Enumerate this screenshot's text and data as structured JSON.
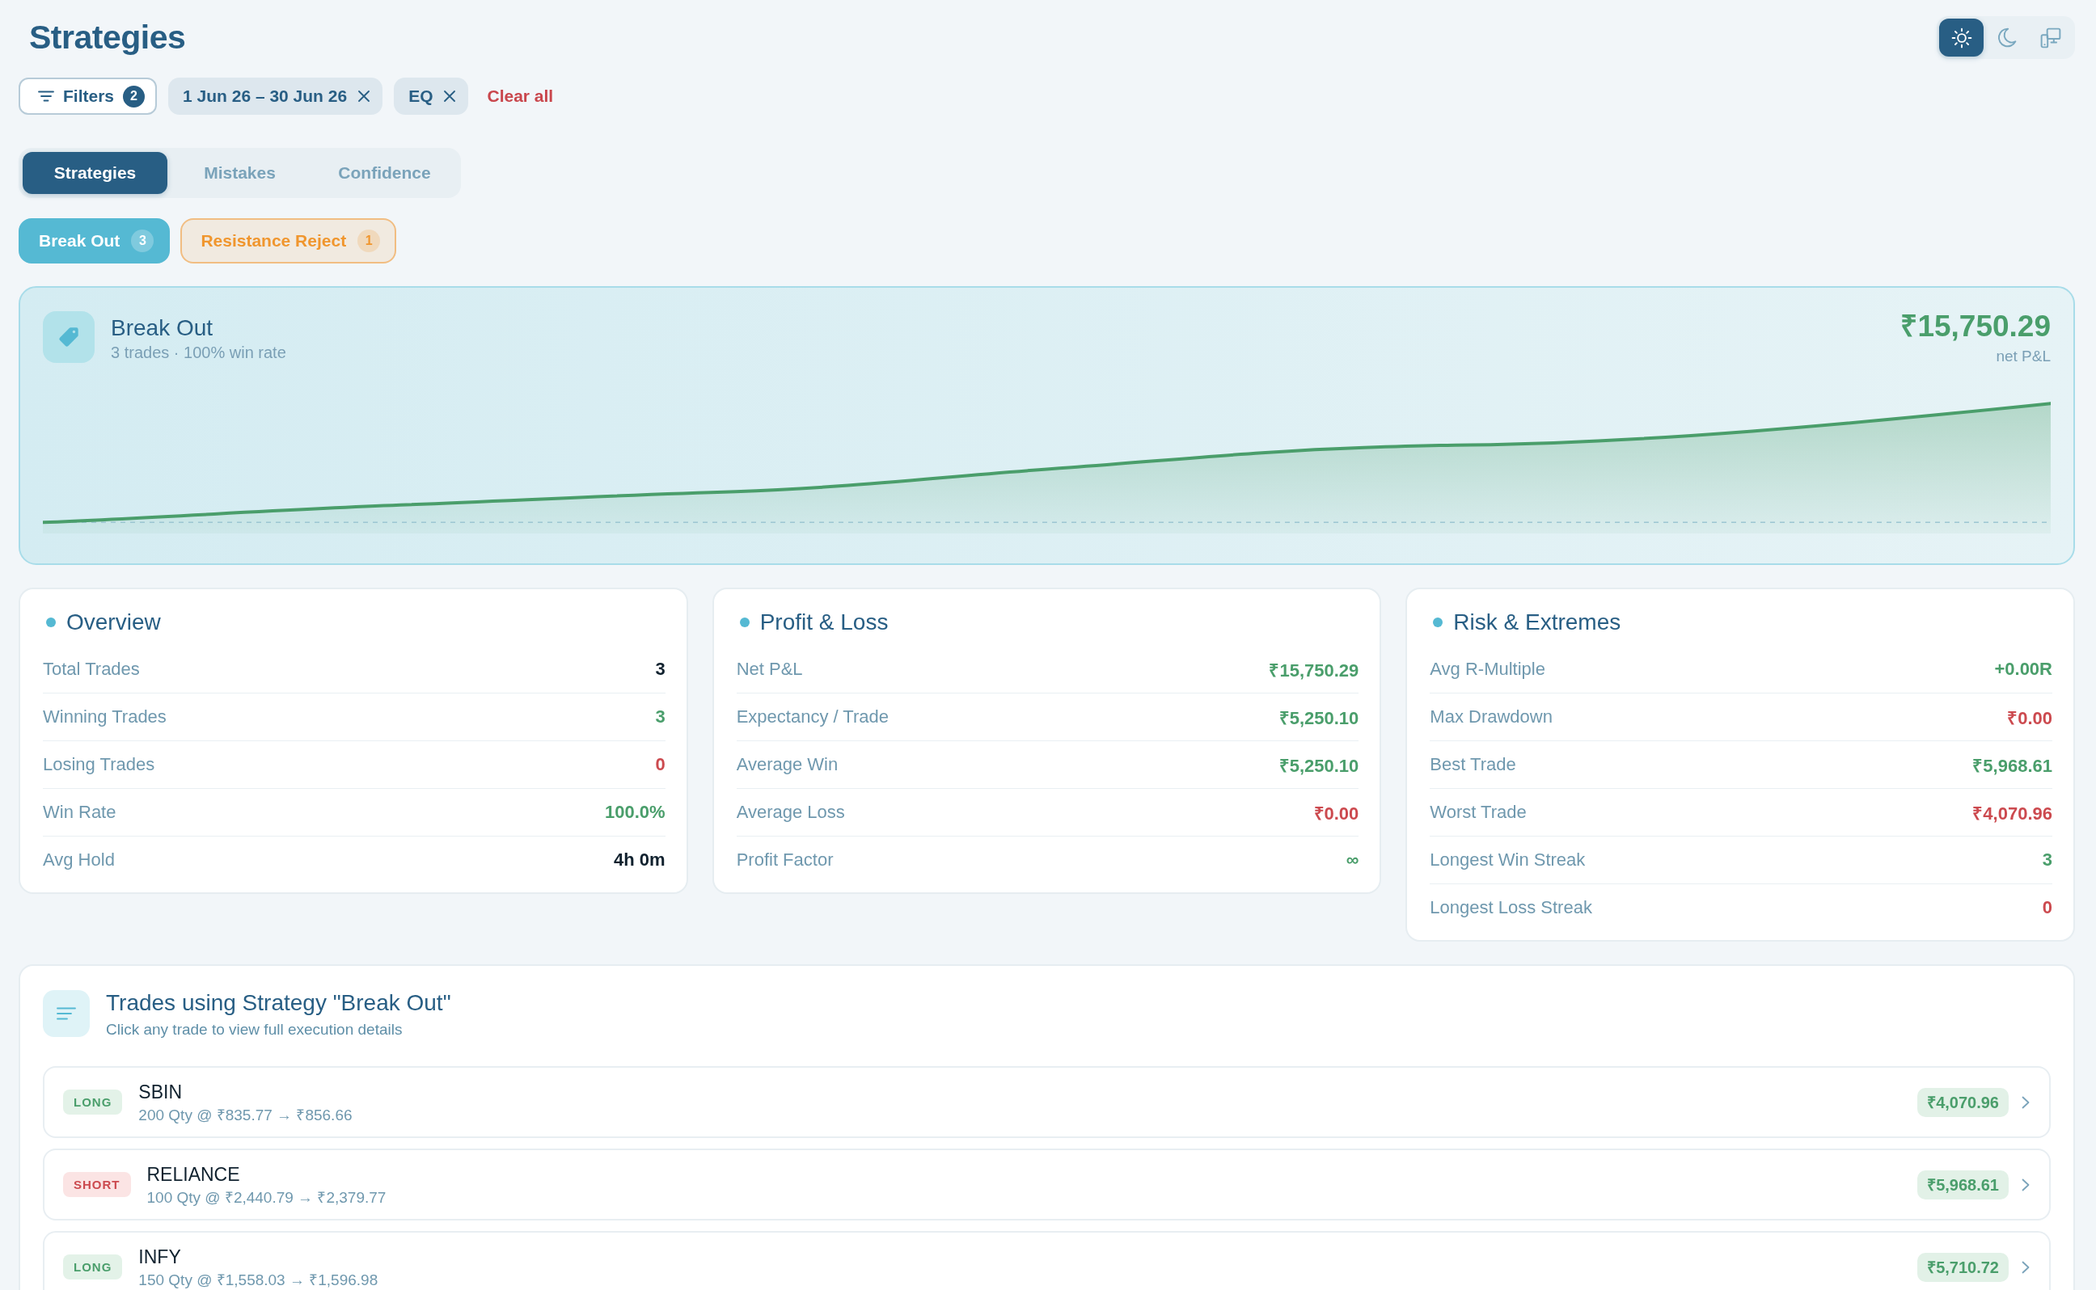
{
  "page_title": "Strategies",
  "theme_options": [
    {
      "kind": "light",
      "selected": true
    },
    {
      "kind": "dark",
      "selected": false
    },
    {
      "kind": "system",
      "selected": false
    }
  ],
  "filters": {
    "label": "Filters",
    "count": "2"
  },
  "active_filters": [
    {
      "label": "1 Jun 26 – 30 Jun 26"
    },
    {
      "label": "EQ"
    }
  ],
  "clear_all": "Clear all",
  "tabs": [
    {
      "label": "Strategies",
      "selected": true
    },
    {
      "label": "Mistakes",
      "selected": false
    },
    {
      "label": "Confidence",
      "selected": false
    }
  ],
  "strategy_chips": [
    {
      "label": "Break Out",
      "count": "3",
      "color": "#55b9d3",
      "selected": true
    },
    {
      "label": "Resistance Reject",
      "count": "1",
      "color": "#f0962e",
      "selected": false
    }
  ],
  "summary": {
    "title": "Break Out",
    "subtitle": "3 trades · 100% win rate",
    "net_pnl": "₹15,750.29",
    "net_pnl_label": "net P&L"
  },
  "stat_cards": [
    {
      "title": "Overview",
      "rows": [
        {
          "label": "Total Trades",
          "value": "3",
          "color": "#10212e"
        },
        {
          "label": "Winning Trades",
          "value": "3",
          "color": "#4a9e6b"
        },
        {
          "label": "Losing Trades",
          "value": "0",
          "color": "#cc4a4f"
        },
        {
          "label": "Win Rate",
          "value": "100.0%",
          "color": "#4a9e6b"
        },
        {
          "label": "Avg Hold",
          "value": "4h 0m",
          "color": "#10212e"
        }
      ]
    },
    {
      "title": "Profit & Loss",
      "rows": [
        {
          "label": "Net P&L",
          "value": "₹15,750.29",
          "color": "#4a9e6b"
        },
        {
          "label": "Expectancy / Trade",
          "value": "₹5,250.10",
          "color": "#4a9e6b"
        },
        {
          "label": "Average Win",
          "value": "₹5,250.10",
          "color": "#4a9e6b"
        },
        {
          "label": "Average Loss",
          "value": "₹0.00",
          "color": "#cc4a4f"
        },
        {
          "label": "Profit Factor",
          "value": "∞",
          "color": "#4a9e6b"
        }
      ]
    },
    {
      "title": "Risk & Extremes",
      "rows": [
        {
          "label": "Avg R-Multiple",
          "value": "+0.00R",
          "color": "#4a9e6b"
        },
        {
          "label": "Max Drawdown",
          "value": "₹0.00",
          "color": "#cc4a4f"
        },
        {
          "label": "Best Trade",
          "value": "₹5,968.61",
          "color": "#4a9e6b"
        },
        {
          "label": "Worst Trade",
          "value": "₹4,070.96",
          "color": "#cc4a4f"
        },
        {
          "label": "Longest Win Streak",
          "value": "3",
          "color": "#4a9e6b"
        },
        {
          "label": "Longest Loss Streak",
          "value": "0",
          "color": "#cc4a4f"
        }
      ]
    }
  ],
  "trades_section": {
    "title": "Trades using Strategy \"Break Out\"",
    "subtitle": "Click any trade to view full execution details",
    "trades": [
      {
        "side": "LONG",
        "kind": "long",
        "symbol": "SBIN",
        "detail": "200 Qty @ ₹835.77 → ₹856.66",
        "pnl": "₹4,070.96"
      },
      {
        "side": "SHORT",
        "kind": "short",
        "symbol": "RELIANCE",
        "detail": "100 Qty @ ₹2,440.79 → ₹2,379.77",
        "pnl": "₹5,968.61"
      },
      {
        "side": "LONG",
        "kind": "long",
        "symbol": "INFY",
        "detail": "150 Qty @ ₹1,558.03 → ₹1,596.98",
        "pnl": "₹5,710.72"
      }
    ]
  }
}
